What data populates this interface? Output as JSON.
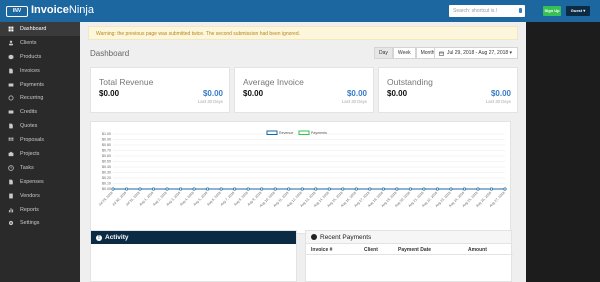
{
  "brand": {
    "mark": "INV",
    "name_bold": "Invoice",
    "name_rest": "Ninja"
  },
  "navbar": {
    "search_placeholder": "Search: shortcut is /",
    "signup_label": "Sign Up",
    "guest_label": "Guest ▾"
  },
  "sidebar": {
    "items": [
      {
        "label": "Dashboard",
        "icon": "dashboard-icon",
        "active": true
      },
      {
        "label": "Clients",
        "icon": "users-icon"
      },
      {
        "label": "Products",
        "icon": "cube-icon"
      },
      {
        "label": "Invoices",
        "icon": "file-icon"
      },
      {
        "label": "Payments",
        "icon": "credit-card-icon"
      },
      {
        "label": "Recurring",
        "icon": "refresh-icon"
      },
      {
        "label": "Credits",
        "icon": "credit-card-icon"
      },
      {
        "label": "Quotes",
        "icon": "file-text-icon"
      },
      {
        "label": "Proposals",
        "icon": "th-icon"
      },
      {
        "label": "Projects",
        "icon": "briefcase-icon"
      },
      {
        "label": "Tasks",
        "icon": "clock-icon"
      },
      {
        "label": "Expenses",
        "icon": "file-image-icon"
      },
      {
        "label": "Vendors",
        "icon": "building-icon"
      },
      {
        "label": "Reports",
        "icon": "bar-chart-icon"
      },
      {
        "label": "Settings",
        "icon": "gear-icon"
      }
    ]
  },
  "warning": "Warning: the previous page was submitted twice. The second submission had been ignored.",
  "page_title": "Dashboard",
  "range_buttons": [
    "Day",
    "Week",
    "Month"
  ],
  "date_range": "Jul 29, 2018 - Aug 27, 2018 ▾",
  "cards": [
    {
      "label": "Total Revenue",
      "value": "$0.00",
      "value_alt": "$0.00",
      "sub": "Last 30 Days"
    },
    {
      "label": "Average Invoice",
      "value": "$0.00",
      "value_alt": "$0.00",
      "sub": "Last 30 Days"
    },
    {
      "label": "Outstanding",
      "value": "$0.00",
      "value_alt": "$0.00",
      "sub": "Last 30 Days"
    }
  ],
  "colors": {
    "revenue": "#1d67a0",
    "payments": "#36c157",
    "nav": "#1d67a0"
  },
  "chart_data": {
    "type": "line",
    "x": [
      "Jul 29, 2018",
      "Jul 30, 2018",
      "Jul 31, 2018",
      "Aug 1, 2018",
      "Aug 2, 2018",
      "Aug 3, 2018",
      "Aug 4, 2018",
      "Aug 5, 2018",
      "Aug 6, 2018",
      "Aug 7, 2018",
      "Aug 8, 2018",
      "Aug 9, 2018",
      "Aug 10, 2018",
      "Aug 11, 2018",
      "Aug 12, 2018",
      "Aug 13, 2018",
      "Aug 14, 2018",
      "Aug 15, 2018",
      "Aug 16, 2018",
      "Aug 17, 2018",
      "Aug 18, 2018",
      "Aug 19, 2018",
      "Aug 20, 2018",
      "Aug 21, 2018",
      "Aug 22, 2018",
      "Aug 23, 2018",
      "Aug 24, 2018",
      "Aug 25, 2018",
      "Aug 26, 2018",
      "Aug 27, 2018"
    ],
    "series": [
      {
        "name": "Revenue",
        "values": [
          0,
          0,
          0,
          0,
          0,
          0,
          0,
          0,
          0,
          0,
          0,
          0,
          0,
          0,
          0,
          0,
          0,
          0,
          0,
          0,
          0,
          0,
          0,
          0,
          0,
          0,
          0,
          0,
          0,
          0
        ]
      },
      {
        "name": "Payments",
        "values": [
          0,
          0,
          0,
          0,
          0,
          0,
          0,
          0,
          0,
          0,
          0,
          0,
          0,
          0,
          0,
          0,
          0,
          0,
          0,
          0,
          0,
          0,
          0,
          0,
          0,
          0,
          0,
          0,
          0,
          0
        ]
      }
    ],
    "y_ticks": [
      "$1.00",
      "$0.90",
      "$0.80",
      "$0.70",
      "$0.60",
      "$0.50",
      "$0.40",
      "$0.30",
      "$0.20",
      "$0.10",
      "$0.00"
    ],
    "ylim": [
      0,
      1
    ],
    "legend_position": "top-center",
    "grid": true
  },
  "activity_title": "Activity",
  "activity_icon_glyph": "!",
  "payments_title": "Recent Payments",
  "payments_columns": [
    "Invoice #",
    "Client",
    "Payment Date",
    "Amount"
  ]
}
